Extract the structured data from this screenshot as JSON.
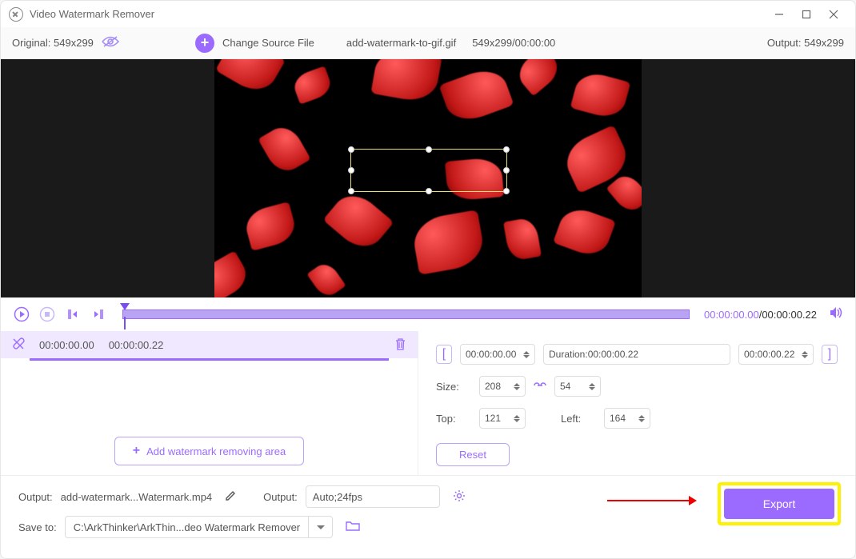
{
  "title": "Video Watermark Remover",
  "toolbar": {
    "original_label": "Original: 549x299",
    "change_source": "Change Source File",
    "filename": "add-watermark-to-gif.gif",
    "dims_time": "549x299/00:00:00",
    "output_label": "Output: 549x299"
  },
  "player": {
    "tc_current": "00:00:00.00",
    "tc_total": "/00:00:00.22"
  },
  "segment": {
    "start": "00:00:00.00",
    "end": "00:00:00.22"
  },
  "add_area_label": "Add watermark removing area",
  "clip": {
    "in": "00:00:00.00",
    "dur_label": "Duration:00:00:00.22",
    "out": "00:00:00.22"
  },
  "size_label": "Size:",
  "size_w": "208",
  "size_h": "54",
  "top_label": "Top:",
  "top_v": "121",
  "left_label": "Left:",
  "left_v": "164",
  "reset_label": "Reset",
  "bottom": {
    "output_label": "Output:",
    "output_file": "add-watermark...Watermark.mp4",
    "output2_label": "Output:",
    "output2_val": "Auto;24fps",
    "saveto_label": "Save to:",
    "saveto_val": "C:\\ArkThinker\\ArkThin...deo Watermark Remover"
  },
  "export_label": "Export"
}
